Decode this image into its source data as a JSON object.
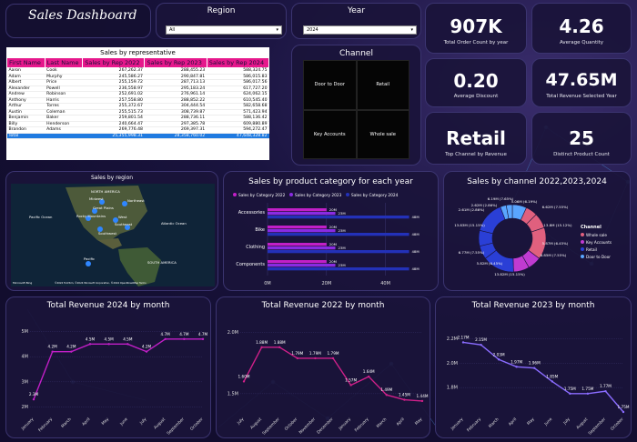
{
  "header": {
    "title": "Sales Dashboard"
  },
  "slicers": {
    "region": {
      "label": "Region",
      "value": "All"
    },
    "year": {
      "label": "Year",
      "value": "2024"
    }
  },
  "kpis": [
    {
      "value": "907K",
      "label": "Total Order Count by year"
    },
    {
      "value": "4.26",
      "label": "Average Quantity"
    },
    {
      "value": "0.20",
      "label": "Average Discount"
    },
    {
      "value": "47.65M",
      "label": "Total Revenue Selected Year"
    },
    {
      "value": "Retail",
      "label": "Top Channel by Revenue"
    },
    {
      "value": "25",
      "label": "Distinct Product Count"
    }
  ],
  "rep_table": {
    "title": "Sales by representative",
    "columns": [
      "First Name",
      "Last Name",
      "Sales by Rep 2022",
      "Sales by Rep 2023",
      "Sales by Rep 2024"
    ],
    "rows": [
      [
        "Aaron",
        "Cook",
        "267,262.37",
        "288,455.23",
        "588,324.75"
      ],
      [
        "Adam",
        "Murphy",
        "245,586.27",
        "290,847.81",
        "586,015.83"
      ],
      [
        "Albert",
        "Price",
        "255,159.72",
        "287,713.13",
        "586,017.56"
      ],
      [
        "Alexander",
        "Powell",
        "236,558.97",
        "295,183.24",
        "617,727.20"
      ],
      [
        "Andrew",
        "Robinson",
        "252,691.02",
        "276,961.14",
        "624,062.15"
      ],
      [
        "Anthony",
        "Harris",
        "257,558.80",
        "288,852.22",
        "610,545.40"
      ],
      [
        "Arthur",
        "Torres",
        "255,372.67",
        "304,444.54",
        "582,658.68"
      ],
      [
        "Austin",
        "Coleman",
        "255,515.73",
        "308,739.87",
        "571,423.94"
      ],
      [
        "Benjamin",
        "Baker",
        "259,801.54",
        "288,736.11",
        "588,136.42"
      ],
      [
        "Billy",
        "Henderson",
        "240,664.47",
        "297,385.78",
        "609,880.89"
      ],
      [
        "Brandon",
        "Adams",
        "269,776.48",
        "269,397.31",
        "594,272.47"
      ]
    ],
    "total": [
      "Total",
      "",
      "25,355,998.31",
      "28,358,760.02",
      "47,648,328.82"
    ]
  },
  "channel_matrix": {
    "title": "Channel",
    "cells": [
      "Door to Door",
      "Retail",
      "Key Accounts",
      "Whole sale"
    ]
  },
  "map": {
    "title": "Sales by region",
    "labels": [
      "NORTH AMERICA",
      "Midwest",
      "Northeast",
      "Great Plains",
      "Rocky Mountains",
      "West",
      "Southeast",
      "Southwest",
      "Pacific Ocean",
      "Atlantic Ocean",
      "Pacific",
      "SOUTH AMERICA",
      "Microsoft Bing",
      "©2024 TomTom, ©2024 Microsoft Corporation, ©2024 OpenStreetMap Terms"
    ]
  },
  "bar_chart": {
    "title": "Sales by product category for each year"
  },
  "donut_chart": {
    "title": "Sales by channel 2022,2023,2024",
    "legend_title": "Channel"
  },
  "line1": {
    "title": "Total Revenue 2024 by month"
  },
  "line2": {
    "title": "Total Revenue 2022 by month"
  },
  "line3": {
    "title": "Total Revenue 2023 by month"
  },
  "colors": {
    "accent": "#e6188c",
    "purple": "#8a2be2",
    "blue": "#1f2fbf",
    "bg": "#120d2e"
  },
  "chart_data": [
    {
      "type": "bar",
      "title": "Sales by product category for each year",
      "categories": [
        "Accessories",
        "Bike",
        "Clothing",
        "Components"
      ],
      "series": [
        {
          "name": "Sales by Category 2022",
          "values": [
            20,
            20,
            20,
            20
          ],
          "labels": [
            "20M",
            "20M",
            "20M",
            "20M"
          ],
          "color": "#c21fc7"
        },
        {
          "name": "Sales by Category 2023",
          "values": [
            23,
            23,
            23,
            23
          ],
          "labels": [
            "23M",
            "23M",
            "23M",
            "23M"
          ],
          "color": "#8a2be2"
        },
        {
          "name": "Sales by Category 2024",
          "values": [
            48,
            48,
            48,
            48
          ],
          "labels": [
            "48M",
            "48M",
            "48M",
            "48M"
          ],
          "color": "#2331b8"
        }
      ],
      "xticks": [
        "0M",
        "20M",
        "40M"
      ],
      "xlim": [
        0,
        50
      ]
    },
    {
      "type": "pie",
      "title": "Sales by channel 2022,2023,2024",
      "legend": [
        {
          "name": "Whole sale",
          "color": "#e0607e"
        },
        {
          "name": "Key Accounts",
          "color": "#c03bd1"
        },
        {
          "name": "Retail",
          "color": "#2a3fd6"
        },
        {
          "name": "Door to Door",
          "color": "#5aa6ff"
        }
      ],
      "slices": [
        {
          "label": "6.19M (7.65%)",
          "value": 6.19,
          "color": "#5aa6ff"
        },
        {
          "label": "5.06M (6.19%)",
          "value": 5.06,
          "color": "#e0607e"
        },
        {
          "label": "6.62M (7.55%)",
          "value": 6.62,
          "color": "#e0607e"
        },
        {
          "label": "13.8M (15.12%)",
          "value": 13.8,
          "color": "#e0607e"
        },
        {
          "label": "5.87M (6.45%)",
          "value": 5.87,
          "color": "#c03bd1"
        },
        {
          "label": "6.85M (7.55%)",
          "value": 6.85,
          "color": "#c03bd1"
        },
        {
          "label": "13.82M (15.15%)",
          "value": 13.82,
          "color": "#2a3fd6"
        },
        {
          "label": "5.82M (6.45%)",
          "value": 5.82,
          "color": "#2a3fd6"
        },
        {
          "label": "6.77M (7.55%)",
          "value": 6.77,
          "color": "#2a3fd6"
        },
        {
          "label": "13.83M (15.15%)",
          "value": 13.83,
          "color": "#2a3fd6"
        },
        {
          "label": "2.61M (2.86%)",
          "value": 2.61,
          "color": "#5aa6ff"
        },
        {
          "label": "2.62M (2.86%)",
          "value": 2.62,
          "color": "#5aa6ff"
        }
      ]
    },
    {
      "type": "line",
      "title": "Total Revenue 2024 by month",
      "x": [
        "January",
        "February",
        "March",
        "April",
        "May",
        "June",
        "July",
        "August",
        "September",
        "October"
      ],
      "values": [
        2.3,
        4.2,
        4.2,
        4.5,
        4.5,
        4.5,
        4.2,
        4.7,
        4.7,
        4.7
      ],
      "labels": [
        "2.3M",
        "4.2M",
        "4.2M",
        "4.5M",
        "4.5M",
        "4.5M",
        "4.2M",
        "4.7M",
        "4.7M",
        "4.7M"
      ],
      "yticks": [
        "2M",
        "3M",
        "4M",
        "5M"
      ],
      "ylim": [
        1.8,
        5.2
      ],
      "color": "#c21fc7"
    },
    {
      "type": "line",
      "title": "Total Revenue 2022 by month",
      "x": [
        "July",
        "August",
        "September",
        "October",
        "November",
        "December",
        "January",
        "February",
        "March",
        "April",
        "May"
      ],
      "values": [
        1.6,
        1.88,
        1.88,
        1.79,
        1.79,
        1.79,
        1.57,
        1.64,
        1.49,
        1.45,
        1.44
      ],
      "labels": [
        "1.60M",
        "1.88M",
        "1.88M",
        "1.79M",
        "1.79M",
        "1.79M",
        "1.57M",
        "1.64M",
        "1.49M",
        "1.45M",
        "1.44M"
      ],
      "yticks": [
        "1.5M",
        "2.0M"
      ],
      "ylim": [
        1.35,
        2.05
      ],
      "color": "#d0208a"
    },
    {
      "type": "line",
      "title": "Total Revenue 2023 by month",
      "x": [
        "January",
        "February",
        "March",
        "April",
        "May",
        "June",
        "July",
        "August",
        "September",
        "October"
      ],
      "values": [
        2.17,
        2.15,
        2.03,
        1.97,
        1.96,
        1.85,
        1.75,
        1.75,
        1.77,
        1.6
      ],
      "labels": [
        "2.17M",
        "2.15M",
        "2.03M",
        "1.97M",
        "1.96M",
        "1.85M",
        "1.75M",
        "1.75M",
        "1.77M",
        "1.75M"
      ],
      "yticks": [
        "1.8M",
        "2.0M",
        "2.2M"
      ],
      "ylim": [
        1.6,
        2.3
      ],
      "color": "#8a6cff"
    }
  ]
}
